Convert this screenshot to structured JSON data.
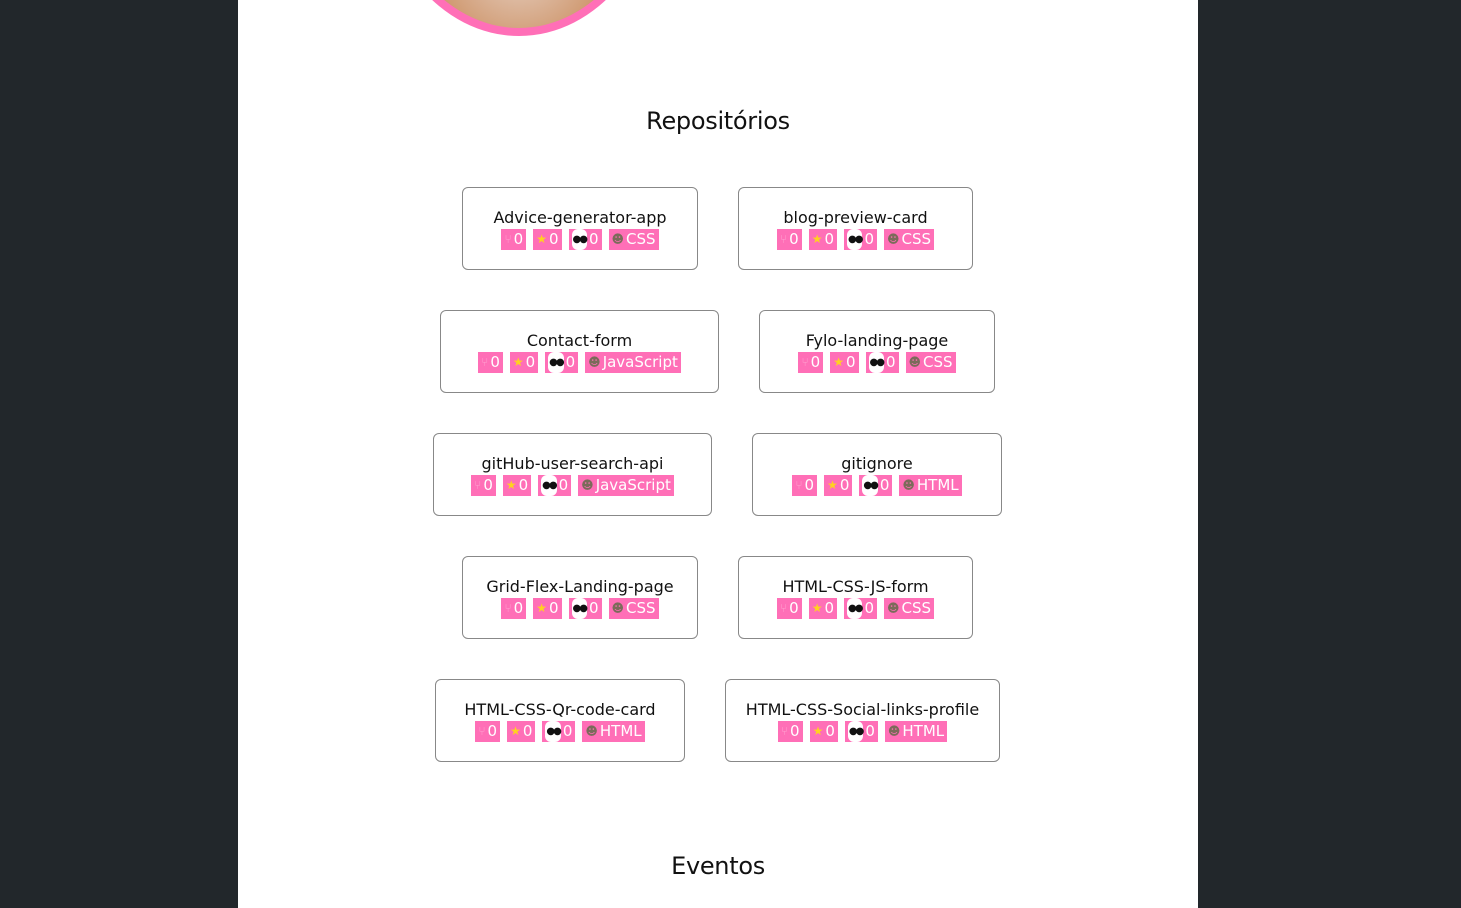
{
  "profile": {
    "avatar_alt": ""
  },
  "sections": {
    "repositories_title": "Repositórios",
    "events_title": "Eventos"
  },
  "icons": {
    "fork": "fork-icon",
    "star": "star-icon",
    "watchers": "eyes-icon",
    "language": "technologist-icon"
  },
  "colors": {
    "accent": "#ff6fb7",
    "background": "#22272b",
    "page": "#ffffff"
  },
  "repos": [
    {
      "name": "Advice-generator-app",
      "forks": "0",
      "stars": "0",
      "watchers": "0",
      "language": "CSS"
    },
    {
      "name": "blog-preview-card",
      "forks": "0",
      "stars": "0",
      "watchers": "0",
      "language": "CSS"
    },
    {
      "name": "Contact-form",
      "forks": "0",
      "stars": "0",
      "watchers": "0",
      "language": "JavaScript"
    },
    {
      "name": "Fylo-landing-page",
      "forks": "0",
      "stars": "0",
      "watchers": "0",
      "language": "CSS"
    },
    {
      "name": "gitHub-user-search-api",
      "forks": "0",
      "stars": "0",
      "watchers": "0",
      "language": "JavaScript"
    },
    {
      "name": "gitignore",
      "forks": "0",
      "stars": "0",
      "watchers": "0",
      "language": "HTML"
    },
    {
      "name": "Grid-Flex-Landing-page",
      "forks": "0",
      "stars": "0",
      "watchers": "0",
      "language": "CSS"
    },
    {
      "name": "HTML-CSS-JS-form",
      "forks": "0",
      "stars": "0",
      "watchers": "0",
      "language": "CSS"
    },
    {
      "name": "HTML-CSS-Qr-code-card",
      "forks": "0",
      "stars": "0",
      "watchers": "0",
      "language": "HTML"
    },
    {
      "name": "HTML-CSS-Social-links-profile",
      "forks": "0",
      "stars": "0",
      "watchers": "0",
      "language": "HTML"
    }
  ]
}
